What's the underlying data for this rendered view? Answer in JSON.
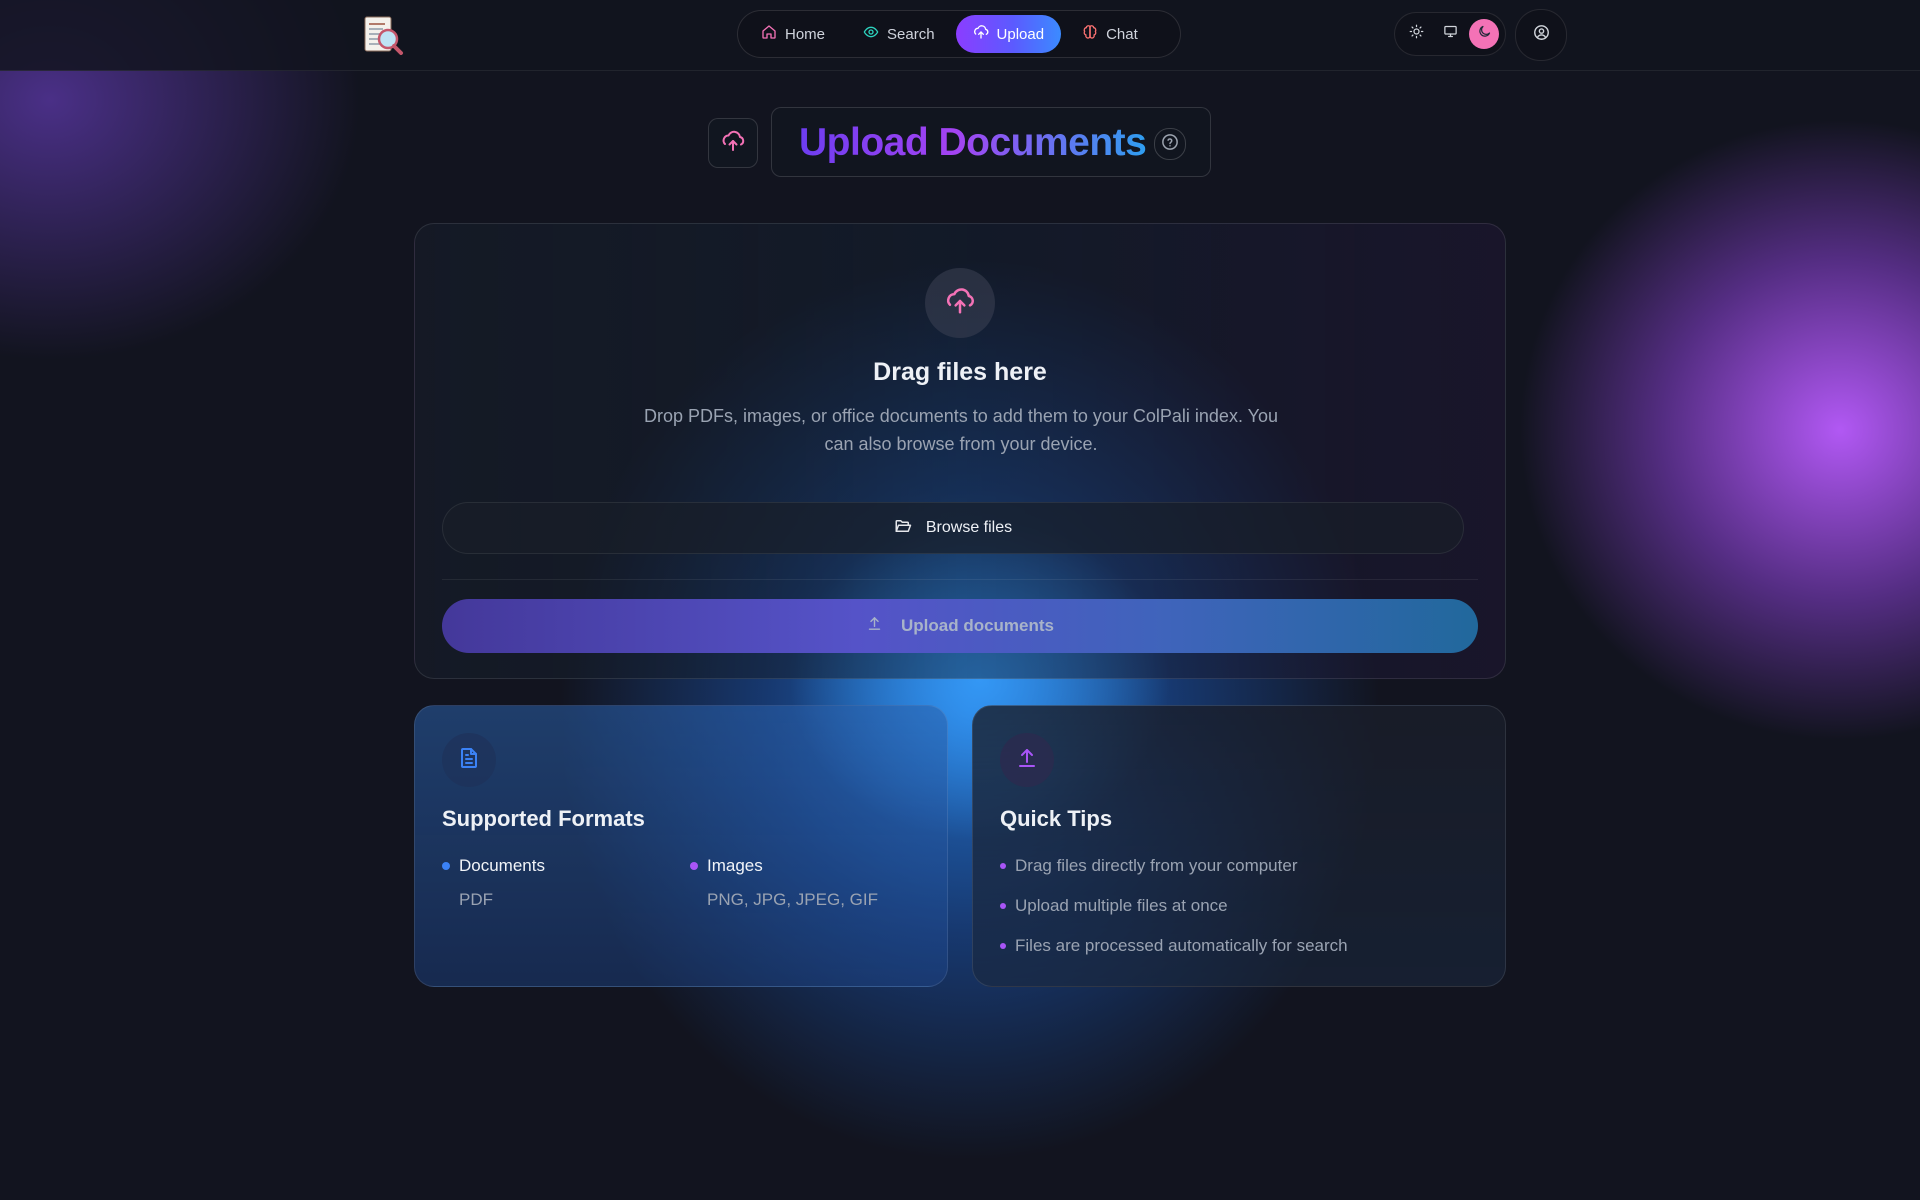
{
  "nav": {
    "items": [
      {
        "label": "Home",
        "icon": "home-icon",
        "color": "#f472b6",
        "active": false
      },
      {
        "label": "Search",
        "icon": "eye-icon",
        "color": "#2dd4bf",
        "active": false
      },
      {
        "label": "Upload",
        "icon": "cloud-upload-icon",
        "color": "#ffffff",
        "active": true
      },
      {
        "label": "Chat",
        "icon": "brain-icon",
        "color": "#f87171",
        "active": false
      }
    ]
  },
  "theme": {
    "options": [
      "sun-icon",
      "monitor-icon",
      "moon-icon"
    ],
    "selected": "moon-icon"
  },
  "page": {
    "title": "Upload Documents"
  },
  "dropzone": {
    "title": "Drag files here",
    "description": "Drop PDFs, images, or office documents to add them to your ColPali index. You can also browse from your device.",
    "browse_label": "Browse files",
    "upload_label": "Upload documents"
  },
  "formats": {
    "title": "Supported Formats",
    "groups": [
      {
        "label": "Documents",
        "value": "PDF",
        "color": "#3b82f6"
      },
      {
        "label": "Images",
        "value": "PNG, JPG, JPEG, GIF",
        "color": "#a855f7"
      }
    ]
  },
  "tips": {
    "title": "Quick Tips",
    "items": [
      "Drag files directly from your computer",
      "Upload multiple files at once",
      "Files are processed automatically for search"
    ]
  },
  "colors": {
    "accent_pink": "#f472b6",
    "accent_purple": "#a855f7",
    "accent_blue": "#3b82f6"
  }
}
